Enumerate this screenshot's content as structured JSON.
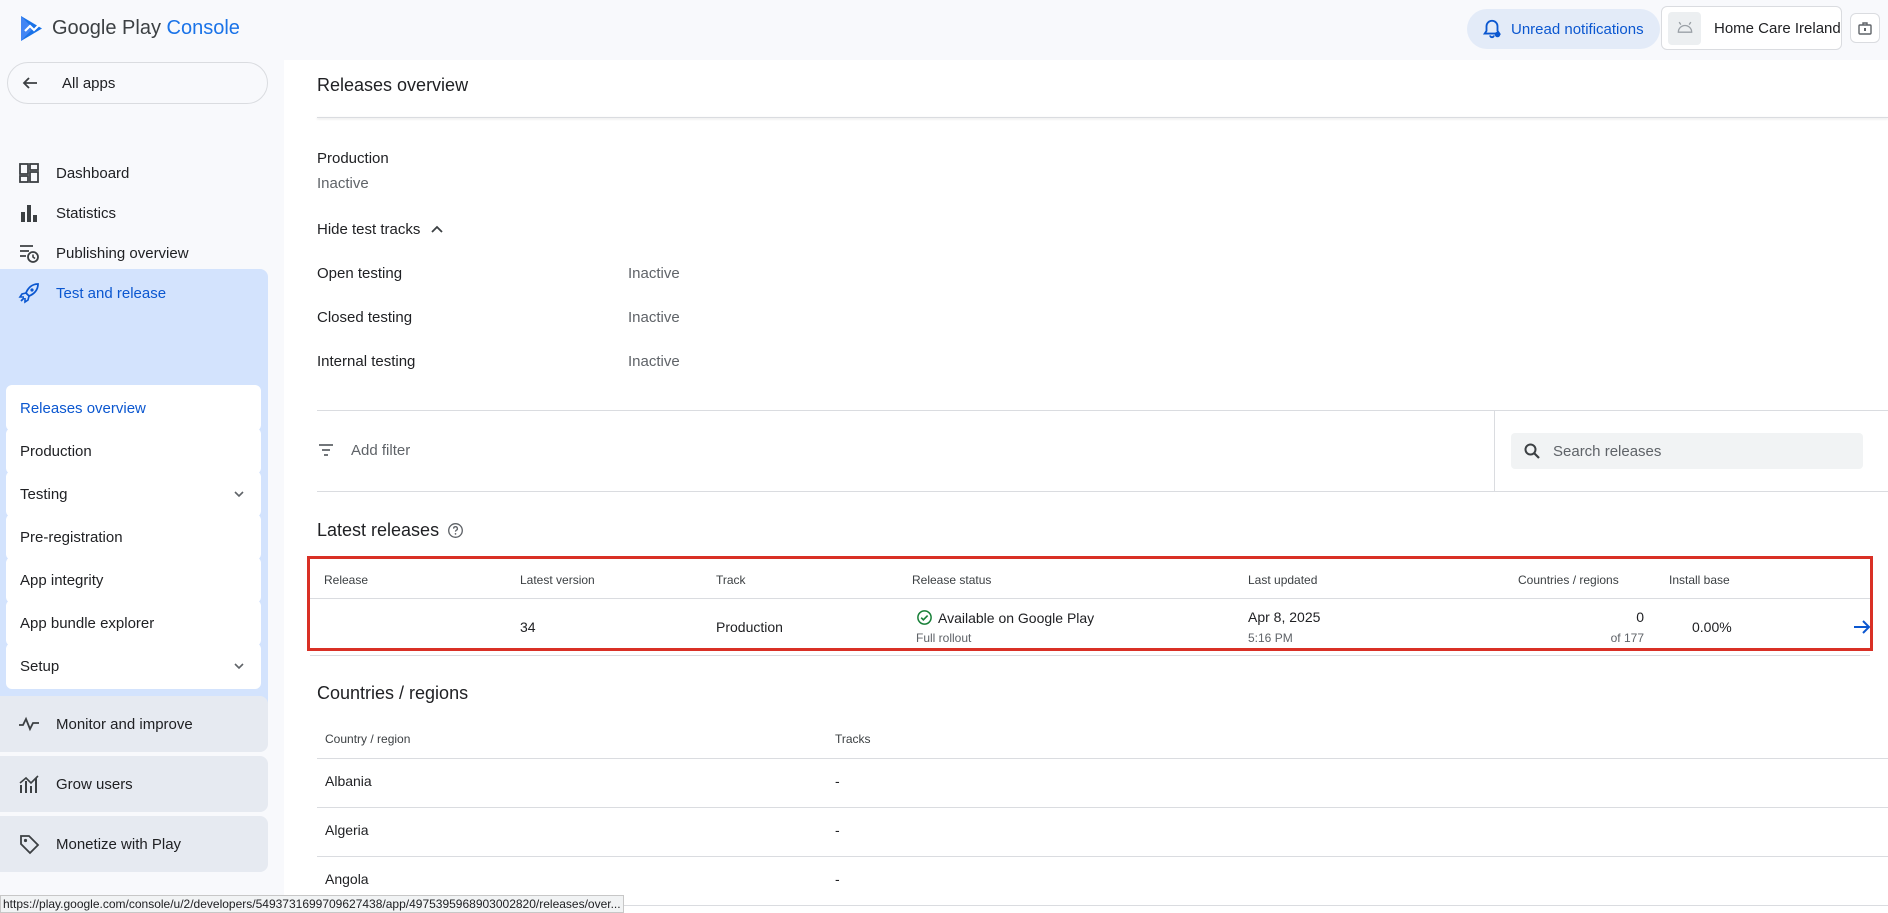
{
  "header": {
    "logo_brand": "Google Play",
    "logo_product": "Console",
    "notifications_label": "Unread notifications",
    "account_name": "Home Care Ireland"
  },
  "sidebar": {
    "all_apps": "All apps",
    "items": [
      {
        "label": "Dashboard",
        "icon": "dashboard-icon"
      },
      {
        "label": "Statistics",
        "icon": "bar-chart-icon"
      },
      {
        "label": "Publishing overview",
        "icon": "schedule-list-icon"
      }
    ],
    "active_section": {
      "label": "Test and release",
      "icon": "rocket-icon",
      "sub_items": [
        {
          "label": "Releases overview",
          "active": true
        },
        {
          "label": "Production"
        },
        {
          "label": "Testing",
          "expandable": true
        },
        {
          "label": "Pre-registration"
        },
        {
          "label": "App integrity"
        },
        {
          "label": "App bundle explorer"
        },
        {
          "label": "Setup",
          "expandable": true
        }
      ]
    },
    "groups": [
      {
        "label": "Monitor and improve",
        "icon": "monitor-icon"
      },
      {
        "label": "Grow users",
        "icon": "grow-icon"
      },
      {
        "label": "Monetize with Play",
        "icon": "tag-icon"
      }
    ]
  },
  "main": {
    "title": "Releases overview",
    "production": {
      "label": "Production",
      "status": "Inactive"
    },
    "hide_test_tracks": "Hide test tracks",
    "test_tracks": [
      {
        "name": "Open testing",
        "status": "Inactive"
      },
      {
        "name": "Closed testing",
        "status": "Inactive"
      },
      {
        "name": "Internal testing",
        "status": "Inactive"
      }
    ],
    "filter": {
      "add_filter": "Add filter",
      "search_placeholder": "Search releases"
    },
    "latest_releases": {
      "title": "Latest releases",
      "columns": [
        "Release",
        "Latest version",
        "Track",
        "Release status",
        "Last updated",
        "Countries / regions",
        "Install base"
      ],
      "rows": [
        {
          "release": "",
          "latest_version": "34",
          "track": "Production",
          "status": "Available on Google Play",
          "status_detail": "Full rollout",
          "last_updated_date": "Apr 8, 2025",
          "last_updated_time": "5:16 PM",
          "countries": "0",
          "countries_total": "of 177",
          "install_base": "0.00%"
        }
      ]
    },
    "countries_regions": {
      "title": "Countries / regions",
      "columns": [
        "Country / region",
        "Tracks"
      ],
      "rows": [
        {
          "country": "Albania",
          "tracks": "-"
        },
        {
          "country": "Algeria",
          "tracks": "-"
        },
        {
          "country": "Angola",
          "tracks": "-"
        }
      ]
    }
  },
  "statusbar_url": "https://play.google.com/console/u/2/developers/5493731699709627438/app/4975395968903002820/releases/over...",
  "colors": {
    "accent": "#0b57d0",
    "active_section_bg": "#d3e3fd",
    "highlight_border": "#d93025",
    "success_green": "#188038"
  }
}
